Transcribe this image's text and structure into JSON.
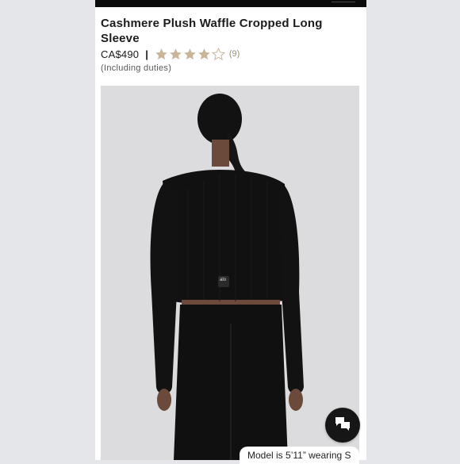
{
  "product": {
    "title": "Cashmere Plush Waffle Cropped Long Sleeve",
    "price": "CA$490",
    "separator": "|",
    "rating": 4,
    "rating_max": 5,
    "review_count": "(9)",
    "duties_note": "(Including duties)"
  },
  "image": {
    "subject": "model-back-view",
    "logo_text": "alo"
  },
  "chat": {
    "icon": "chat-bubbles-icon"
  },
  "caption": {
    "model_info": "Model is 5’11” wearing S"
  },
  "colors": {
    "star_filled": "#c8b59a",
    "star_empty": "#c8b59a",
    "garment": "#111111",
    "backdrop": "#dcdcde"
  }
}
